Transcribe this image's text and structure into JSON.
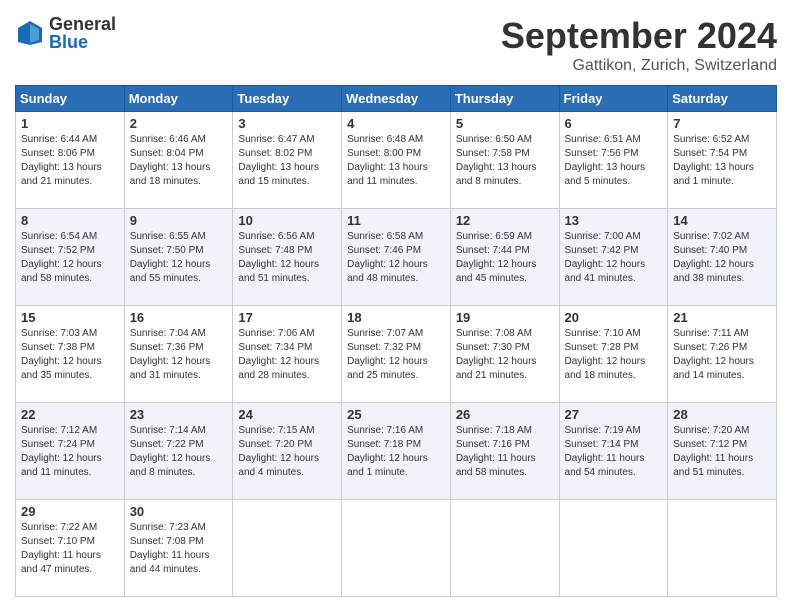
{
  "header": {
    "logo_general": "General",
    "logo_blue": "Blue",
    "month_title": "September 2024",
    "location": "Gattikon, Zurich, Switzerland"
  },
  "weekdays": [
    "Sunday",
    "Monday",
    "Tuesday",
    "Wednesday",
    "Thursday",
    "Friday",
    "Saturday"
  ],
  "weeks": [
    [
      {
        "day": "1",
        "info": "Sunrise: 6:44 AM\nSunset: 8:06 PM\nDaylight: 13 hours\nand 21 minutes."
      },
      {
        "day": "2",
        "info": "Sunrise: 6:46 AM\nSunset: 8:04 PM\nDaylight: 13 hours\nand 18 minutes."
      },
      {
        "day": "3",
        "info": "Sunrise: 6:47 AM\nSunset: 8:02 PM\nDaylight: 13 hours\nand 15 minutes."
      },
      {
        "day": "4",
        "info": "Sunrise: 6:48 AM\nSunset: 8:00 PM\nDaylight: 13 hours\nand 11 minutes."
      },
      {
        "day": "5",
        "info": "Sunrise: 6:50 AM\nSunset: 7:58 PM\nDaylight: 13 hours\nand 8 minutes."
      },
      {
        "day": "6",
        "info": "Sunrise: 6:51 AM\nSunset: 7:56 PM\nDaylight: 13 hours\nand 5 minutes."
      },
      {
        "day": "7",
        "info": "Sunrise: 6:52 AM\nSunset: 7:54 PM\nDaylight: 13 hours\nand 1 minute."
      }
    ],
    [
      {
        "day": "8",
        "info": "Sunrise: 6:54 AM\nSunset: 7:52 PM\nDaylight: 12 hours\nand 58 minutes."
      },
      {
        "day": "9",
        "info": "Sunrise: 6:55 AM\nSunset: 7:50 PM\nDaylight: 12 hours\nand 55 minutes."
      },
      {
        "day": "10",
        "info": "Sunrise: 6:56 AM\nSunset: 7:48 PM\nDaylight: 12 hours\nand 51 minutes."
      },
      {
        "day": "11",
        "info": "Sunrise: 6:58 AM\nSunset: 7:46 PM\nDaylight: 12 hours\nand 48 minutes."
      },
      {
        "day": "12",
        "info": "Sunrise: 6:59 AM\nSunset: 7:44 PM\nDaylight: 12 hours\nand 45 minutes."
      },
      {
        "day": "13",
        "info": "Sunrise: 7:00 AM\nSunset: 7:42 PM\nDaylight: 12 hours\nand 41 minutes."
      },
      {
        "day": "14",
        "info": "Sunrise: 7:02 AM\nSunset: 7:40 PM\nDaylight: 12 hours\nand 38 minutes."
      }
    ],
    [
      {
        "day": "15",
        "info": "Sunrise: 7:03 AM\nSunset: 7:38 PM\nDaylight: 12 hours\nand 35 minutes."
      },
      {
        "day": "16",
        "info": "Sunrise: 7:04 AM\nSunset: 7:36 PM\nDaylight: 12 hours\nand 31 minutes."
      },
      {
        "day": "17",
        "info": "Sunrise: 7:06 AM\nSunset: 7:34 PM\nDaylight: 12 hours\nand 28 minutes."
      },
      {
        "day": "18",
        "info": "Sunrise: 7:07 AM\nSunset: 7:32 PM\nDaylight: 12 hours\nand 25 minutes."
      },
      {
        "day": "19",
        "info": "Sunrise: 7:08 AM\nSunset: 7:30 PM\nDaylight: 12 hours\nand 21 minutes."
      },
      {
        "day": "20",
        "info": "Sunrise: 7:10 AM\nSunset: 7:28 PM\nDaylight: 12 hours\nand 18 minutes."
      },
      {
        "day": "21",
        "info": "Sunrise: 7:11 AM\nSunset: 7:26 PM\nDaylight: 12 hours\nand 14 minutes."
      }
    ],
    [
      {
        "day": "22",
        "info": "Sunrise: 7:12 AM\nSunset: 7:24 PM\nDaylight: 12 hours\nand 11 minutes."
      },
      {
        "day": "23",
        "info": "Sunrise: 7:14 AM\nSunset: 7:22 PM\nDaylight: 12 hours\nand 8 minutes."
      },
      {
        "day": "24",
        "info": "Sunrise: 7:15 AM\nSunset: 7:20 PM\nDaylight: 12 hours\nand 4 minutes."
      },
      {
        "day": "25",
        "info": "Sunrise: 7:16 AM\nSunset: 7:18 PM\nDaylight: 12 hours\nand 1 minute."
      },
      {
        "day": "26",
        "info": "Sunrise: 7:18 AM\nSunset: 7:16 PM\nDaylight: 11 hours\nand 58 minutes."
      },
      {
        "day": "27",
        "info": "Sunrise: 7:19 AM\nSunset: 7:14 PM\nDaylight: 11 hours\nand 54 minutes."
      },
      {
        "day": "28",
        "info": "Sunrise: 7:20 AM\nSunset: 7:12 PM\nDaylight: 11 hours\nand 51 minutes."
      }
    ],
    [
      {
        "day": "29",
        "info": "Sunrise: 7:22 AM\nSunset: 7:10 PM\nDaylight: 11 hours\nand 47 minutes."
      },
      {
        "day": "30",
        "info": "Sunrise: 7:23 AM\nSunset: 7:08 PM\nDaylight: 11 hours\nand 44 minutes."
      },
      {
        "day": "",
        "info": ""
      },
      {
        "day": "",
        "info": ""
      },
      {
        "day": "",
        "info": ""
      },
      {
        "day": "",
        "info": ""
      },
      {
        "day": "",
        "info": ""
      }
    ]
  ]
}
